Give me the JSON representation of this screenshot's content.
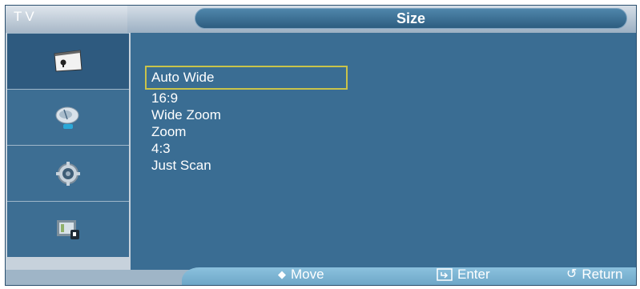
{
  "header": {
    "source_label": "TV",
    "title": "Size"
  },
  "sidebar": {
    "items": [
      {
        "icon": "picture-icon",
        "active": true
      },
      {
        "icon": "satellite-icon",
        "active": false
      },
      {
        "icon": "setup-gear-icon",
        "active": false
      },
      {
        "icon": "input-icon",
        "active": false
      }
    ]
  },
  "menu": {
    "selected_index": 0,
    "items": [
      "Auto Wide",
      "16:9",
      "Wide Zoom",
      "Zoom",
      "4:3",
      "Just Scan"
    ]
  },
  "footer": {
    "move_label": "Move",
    "enter_label": "Enter",
    "return_label": "Return"
  },
  "colors": {
    "background": "#3a6d93",
    "highlight_border": "#c9c34a",
    "footer_bar": "#7db5d6"
  }
}
